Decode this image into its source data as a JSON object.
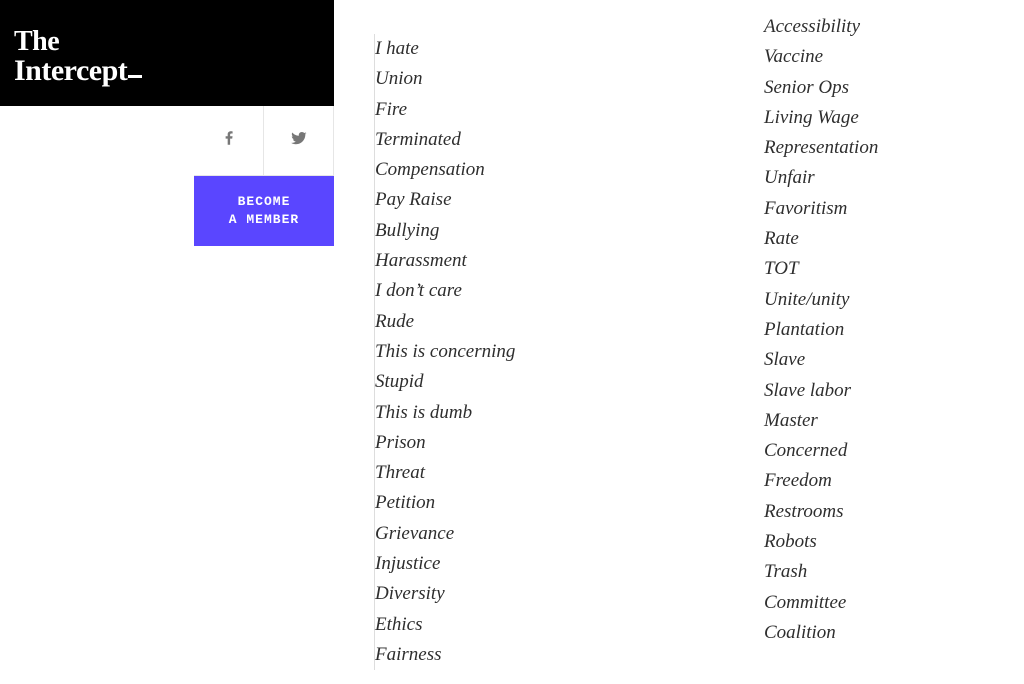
{
  "brand": {
    "line1": "The",
    "line2": "Intercept"
  },
  "cta": {
    "line1": "BECOME",
    "line2": "A MEMBER"
  },
  "columns": {
    "left": [
      "I hate",
      "Union",
      "Fire",
      "Terminated",
      "Compensation",
      "Pay Raise",
      "Bullying",
      "Harassment",
      "I don’t care",
      "Rude",
      "This is concerning",
      "Stupid",
      "This is dumb",
      "Prison",
      "Threat",
      "Petition",
      "Grievance",
      "Injustice",
      "Diversity",
      "Ethics",
      "Fairness"
    ],
    "right": [
      "Accessibility",
      "Vaccine",
      "Senior Ops",
      "Living Wage",
      "Representation",
      "Unfair",
      "Favoritism",
      "Rate",
      "TOT",
      "Unite/unity",
      "Plantation",
      "Slave",
      "Slave labor",
      "Master",
      "Concerned",
      "Freedom",
      "Restrooms",
      "Robots",
      "Trash",
      "Committee",
      "Coalition"
    ]
  }
}
